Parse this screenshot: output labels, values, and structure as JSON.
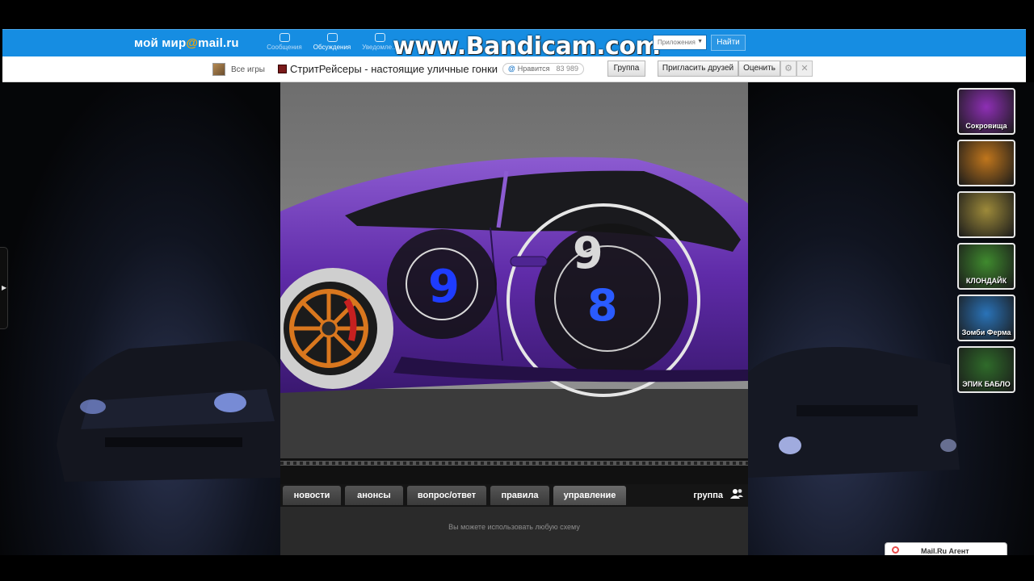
{
  "header": {
    "logo_prefix": "мой мир",
    "logo_at": "@",
    "logo_suffix": "mail.ru",
    "nav": [
      {
        "label": "Сообщения"
      },
      {
        "label": "Обсуждения"
      },
      {
        "label": "Уведомле..."
      }
    ],
    "watermark": "www.Bandicam.com",
    "apps_select": "Приложения",
    "find_button": "Найти"
  },
  "game_bar": {
    "all_games": "Все игры",
    "title": "СтритРейсеры - настоящие уличные гонки",
    "like_label": "Нравится",
    "like_count": "83 989",
    "group_button": "Группа",
    "invite_button": "Пригласить друзей",
    "rate_button": "Оценить"
  },
  "game": {
    "tabs": [
      "новости",
      "анонсы",
      "вопрос/ответ",
      "правила",
      "управление"
    ],
    "active_tab": "управление",
    "group_link": "группа",
    "hint": "Вы можете использовать любую схему"
  },
  "promos": [
    {
      "label": "Сокровища",
      "color": "#8e2fb5"
    },
    {
      "label": "",
      "color": "#c0761c"
    },
    {
      "label": "",
      "color": "#9d8a3a"
    },
    {
      "label": "КЛОНДАЙК",
      "color": "#3f8a2e"
    },
    {
      "label": "Зомби Ферма",
      "color": "#2a73b8"
    },
    {
      "label": "ЭПИК БАБЛО",
      "color": "#2f6b2a"
    }
  ],
  "agent": {
    "label": "Mail.Ru Агент"
  },
  "colors": {
    "mail_blue": "#168de2",
    "car_purple": "#6a2fb0",
    "accent_blue": "#1e3cff"
  }
}
